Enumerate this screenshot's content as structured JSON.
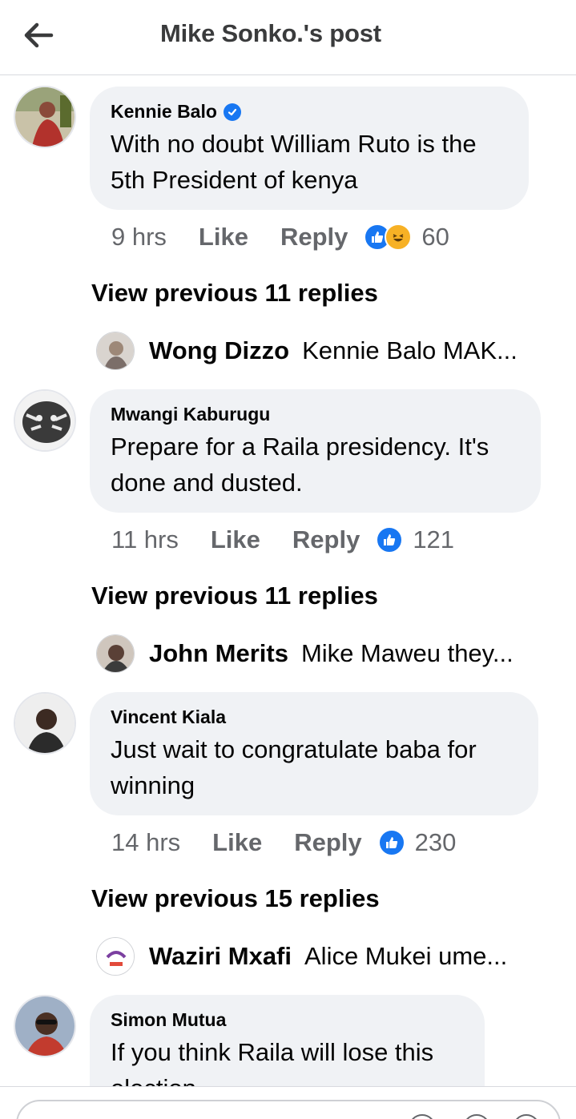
{
  "header": {
    "title": "Mike Sonko.'s post"
  },
  "comments": [
    {
      "author": "Kennie Balo",
      "verified": true,
      "text": "With no doubt William Ruto is the 5th President of kenya",
      "time": "9 hrs",
      "like_label": "Like",
      "reply_label": "Reply",
      "reactions": [
        "like",
        "haha"
      ],
      "reaction_count": "60",
      "view_previous": "View previous 11 replies",
      "latest_reply": {
        "name": "Wong Dizzo",
        "snippet": "Kennie Balo MAK..."
      }
    },
    {
      "author": "Mwangi Kaburugu",
      "verified": false,
      "text": "Prepare for a Raila presidency. It's done and dusted.",
      "time": "11 hrs",
      "like_label": "Like",
      "reply_label": "Reply",
      "reactions": [
        "like"
      ],
      "reaction_count": "121",
      "view_previous": "View previous 11 replies",
      "latest_reply": {
        "name": "John Merits",
        "snippet": "Mike Maweu they..."
      }
    },
    {
      "author": "Vincent Kiala",
      "verified": false,
      "text": "Just wait to congratulate baba for winning",
      "time": "14 hrs",
      "like_label": "Like",
      "reply_label": "Reply",
      "reactions": [
        "like"
      ],
      "reaction_count": "230",
      "view_previous": "View previous 15 replies",
      "latest_reply": {
        "name": "Waziri Mxafi",
        "snippet": "Alice Mukei ume..."
      }
    },
    {
      "author": "Simon Mutua",
      "verified": false,
      "text": "If you think Raila will lose this election"
    }
  ],
  "colors": {
    "accent": "#1877f2",
    "bubble": "#f0f2f5",
    "meta": "#65676b",
    "haha": "#f7b125"
  }
}
